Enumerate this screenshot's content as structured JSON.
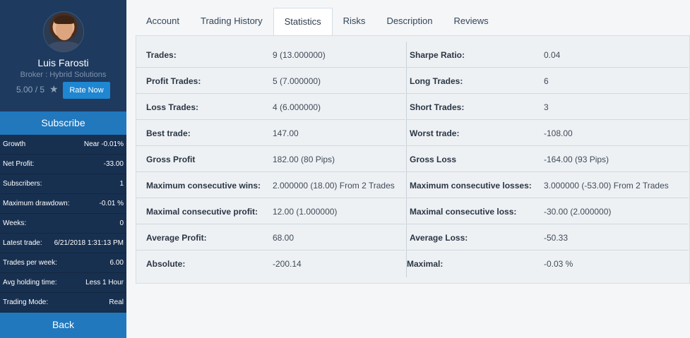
{
  "profile": {
    "name": "Luis Farosti",
    "broker": "Broker : Hybrid Solutions",
    "rating": "5.00 / 5",
    "rate_button": "Rate Now"
  },
  "subscribe_label": "Subscribe",
  "back_label": "Back",
  "sidebar_stats": [
    {
      "label": "Growth",
      "value": "Near -0.01%"
    },
    {
      "label": "Net Profit:",
      "value": "-33.00"
    },
    {
      "label": "Subscribers:",
      "value": "1"
    },
    {
      "label": "Maximum drawdown:",
      "value": "-0.01 %"
    },
    {
      "label": "Weeks:",
      "value": "0"
    },
    {
      "label": "Latest trade:",
      "value": "6/21/2018 1:31:13 PM"
    },
    {
      "label": "Trades per week:",
      "value": "6.00"
    },
    {
      "label": "Avg holding time:",
      "value": "Less 1 Hour"
    },
    {
      "label": "Trading Mode:",
      "value": "Real"
    }
  ],
  "tabs": [
    {
      "label": "Account"
    },
    {
      "label": "Trading History"
    },
    {
      "label": "Statistics",
      "active": true
    },
    {
      "label": "Risks"
    },
    {
      "label": "Description"
    },
    {
      "label": "Reviews"
    }
  ],
  "statistics": {
    "left": [
      {
        "label": "Trades:",
        "value": "9 (13.000000)"
      },
      {
        "label": "Profit Trades:",
        "value": "5 (7.000000)"
      },
      {
        "label": "Loss Trades:",
        "value": "4 (6.000000)"
      },
      {
        "label": "Best trade:",
        "value": "147.00"
      },
      {
        "label": "Gross Profit",
        "value": "182.00 (80 Pips)"
      },
      {
        "label": "Maximum consecutive wins:",
        "value": "2.000000 (18.00) From 2 Trades"
      },
      {
        "label": "Maximal consecutive profit:",
        "value": "12.00 (1.000000)"
      },
      {
        "label": "Average Profit:",
        "value": "68.00"
      },
      {
        "label": "Absolute:",
        "value": "-200.14"
      }
    ],
    "right": [
      {
        "label": "Sharpe Ratio:",
        "value": "0.04"
      },
      {
        "label": "Long Trades:",
        "value": "6"
      },
      {
        "label": "Short Trades:",
        "value": "3"
      },
      {
        "label": "Worst trade:",
        "value": "-108.00"
      },
      {
        "label": "Gross Loss",
        "value": "-164.00 (93 Pips)"
      },
      {
        "label": "Maximum consecutive losses:",
        "value": "3.000000 (-53.00) From 2 Trades"
      },
      {
        "label": "Maximal consecutive loss:",
        "value": "-30.00 (2.000000)"
      },
      {
        "label": "Average Loss:",
        "value": "-50.33"
      },
      {
        "label": "Maximal:",
        "value": "-0.03 %"
      }
    ]
  },
  "colors": {
    "sidebar_bg": "#1c3557",
    "accent_blue": "#2178bd",
    "rate_button": "#1f86d1"
  },
  "icons": {
    "rating_star": "star-icon"
  }
}
